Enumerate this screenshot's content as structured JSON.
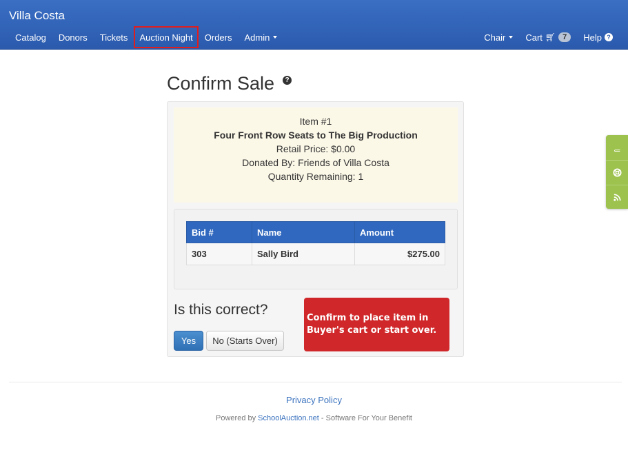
{
  "navbar": {
    "brand": "Villa Costa",
    "left_items": [
      "Catalog",
      "Donors",
      "Tickets",
      "Auction Night",
      "Orders",
      "Admin"
    ],
    "highlighted_item": "Auction Night",
    "chair_label": "Chair",
    "cart_label": "Cart",
    "cart_count": "7",
    "help_label": "Help"
  },
  "page": {
    "title": "Confirm Sale"
  },
  "item": {
    "number": "Item #1",
    "name": "Four Front Row Seats to The Big Production",
    "retail_price": "Retail Price: $0.00",
    "donated_by": "Donated By: Friends of Villa Costa",
    "quantity_remaining": "Quantity Remaining: 1"
  },
  "bids_table": {
    "headers": [
      "Bid #",
      "Name",
      "Amount"
    ],
    "rows": [
      {
        "bid": "303",
        "name": "Sally Bird",
        "amount": "$275.00"
      }
    ]
  },
  "confirm": {
    "question": "Is this correct?",
    "yes_label": "Yes",
    "no_label": "No (Starts Over)"
  },
  "callout": {
    "line1": "Confirm to place item in",
    "line2": "Buyer's cart or start over."
  },
  "side_tabs": [
    "book-icon",
    "lifebuoy-icon",
    "rss-icon"
  ],
  "footer": {
    "privacy": "Privacy Policy",
    "powered_prefix": "Powered by ",
    "powered_link": "SchoolAuction.net",
    "powered_suffix": " - Software For Your Benefit"
  },
  "colors": {
    "navbar": "#2f62b8",
    "highlight_box": "#e01e1e",
    "callout": "#d0282a",
    "side_tabs": "#9dc24e",
    "table_header": "#3068bf",
    "item_box": "#fcf8e8"
  }
}
